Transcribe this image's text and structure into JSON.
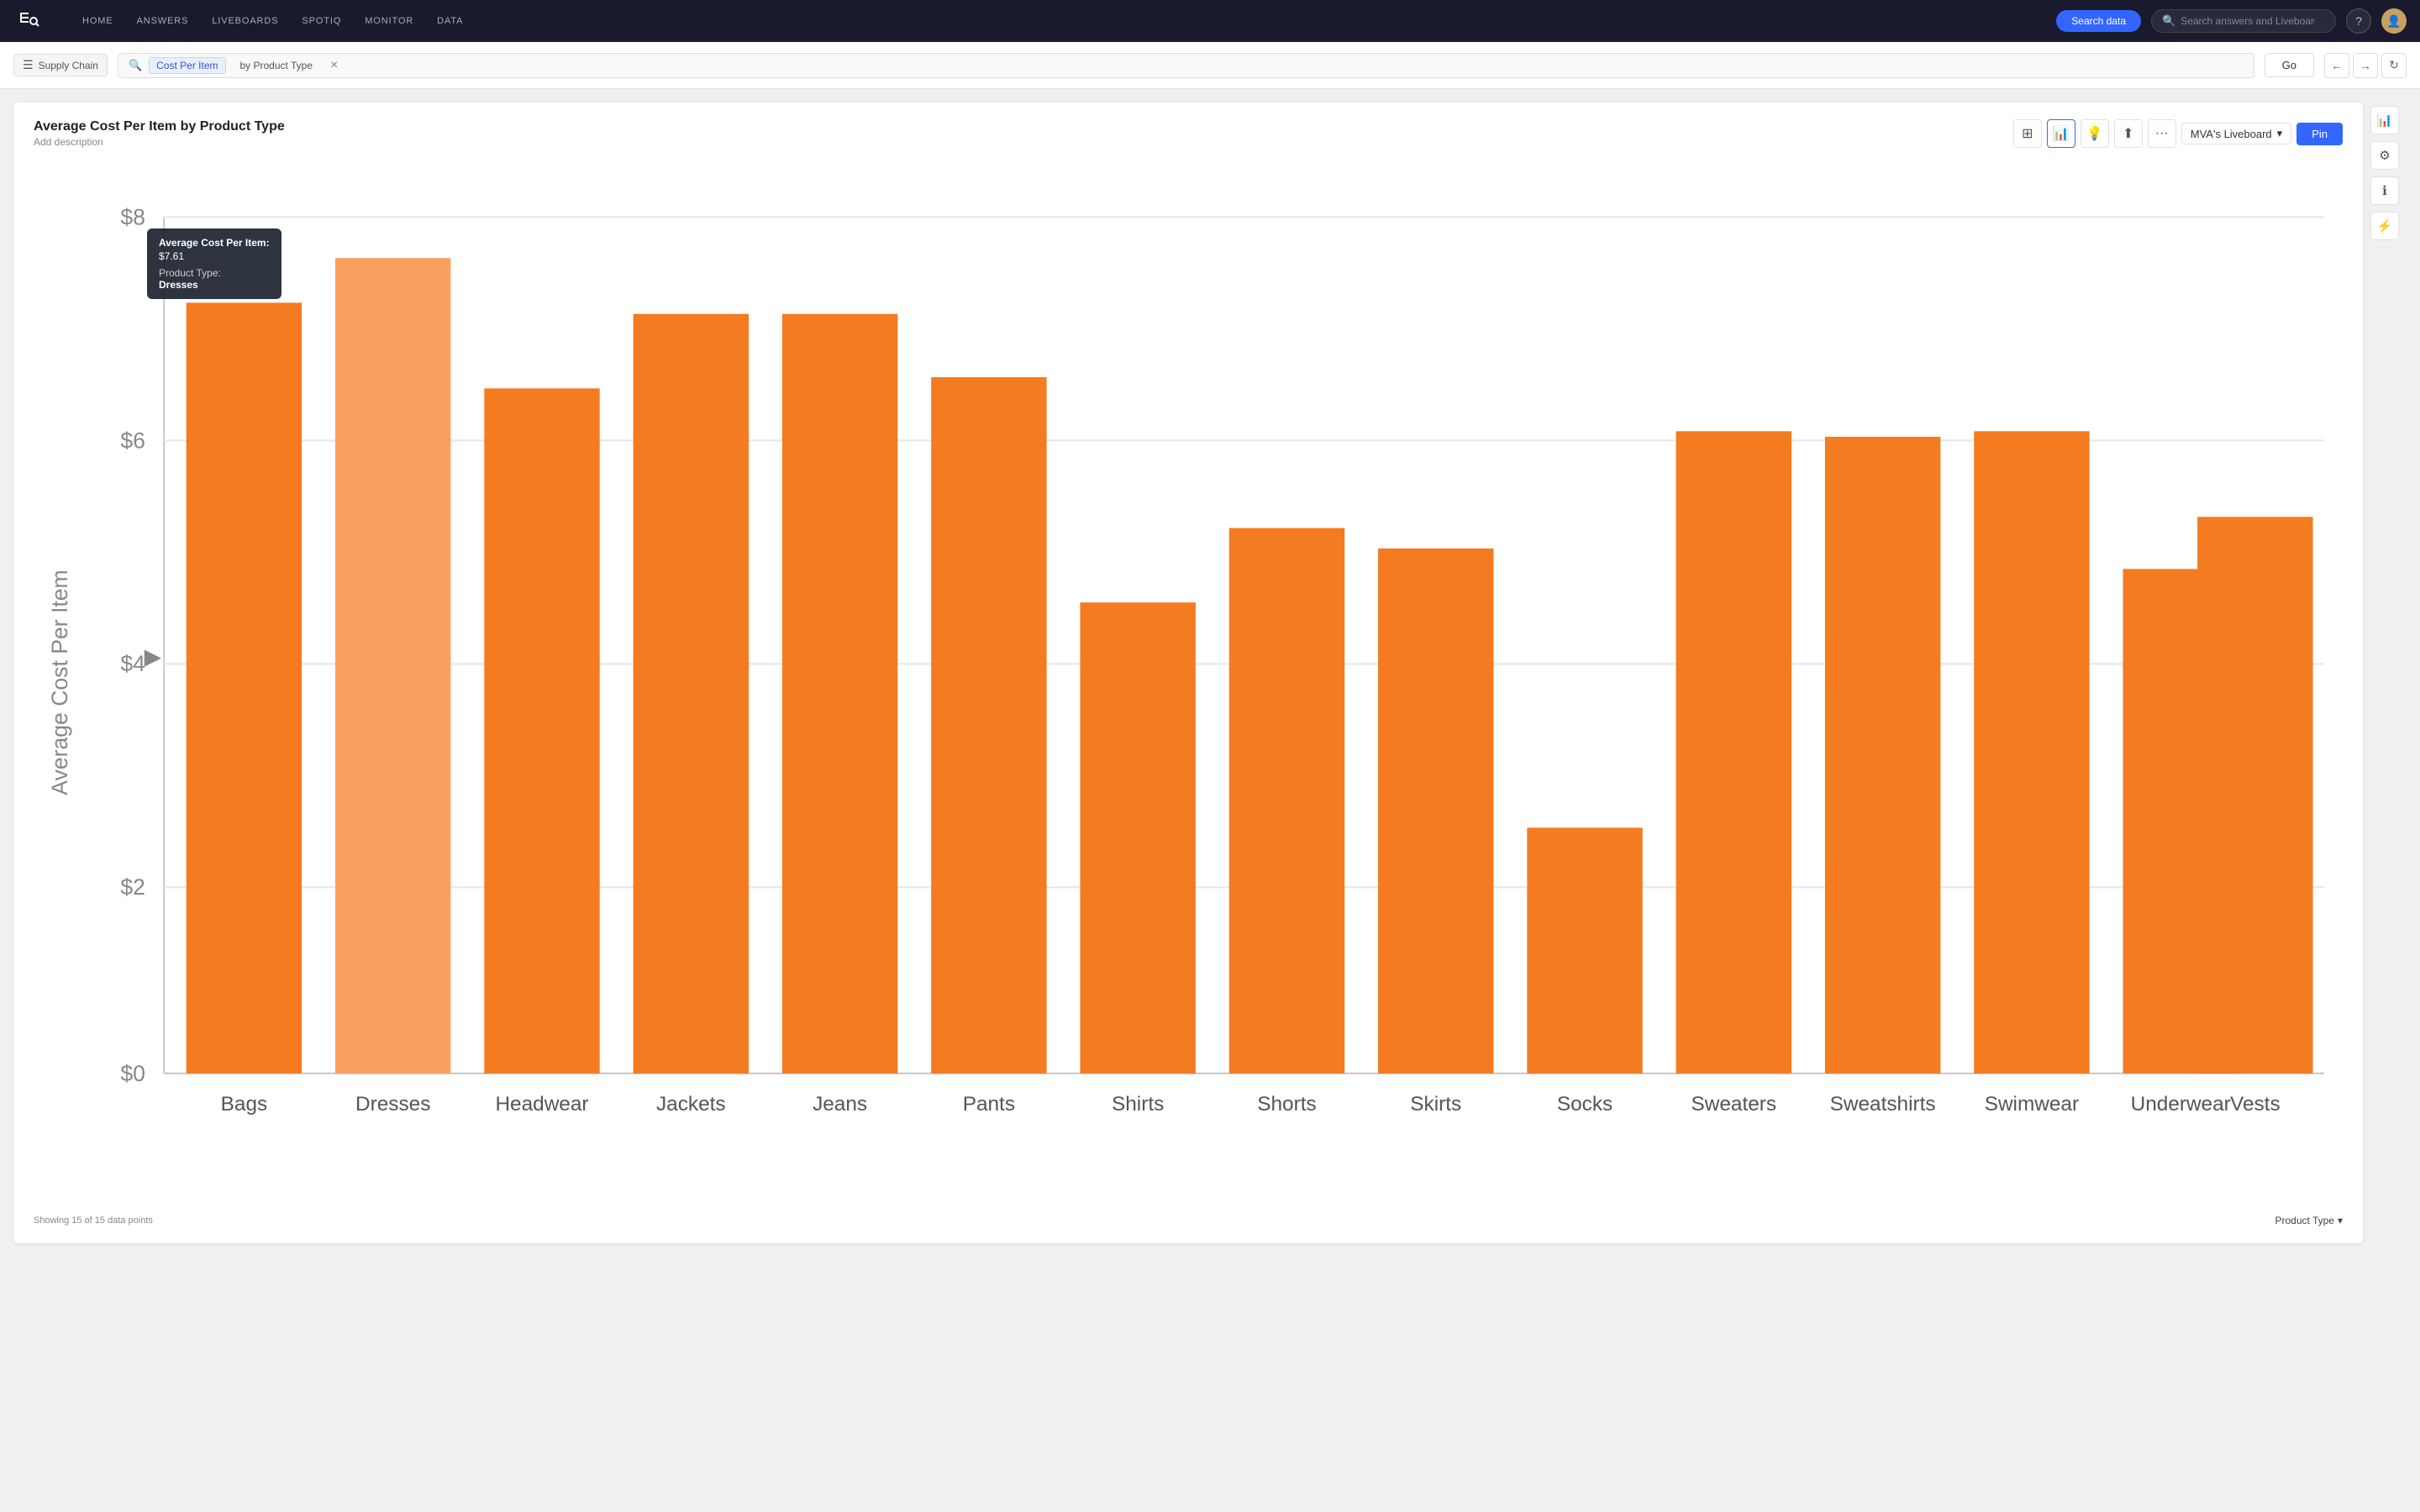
{
  "nav": {
    "links": [
      "HOME",
      "ANSWERS",
      "LIVEBOARDS",
      "SPOTIQ",
      "MONITOR",
      "DATA"
    ],
    "search_data_label": "Search data",
    "search_answers_placeholder": "Search answers and Liveboards"
  },
  "search_bar": {
    "source_icon": "≡",
    "source_label": "Supply Chain",
    "search_icon": "🔍",
    "token1": "Cost Per Item",
    "token2": "by Product Type",
    "go_label": "Go"
  },
  "chart": {
    "title": "Average Cost Per Item by Product Type",
    "subtitle": "Add description",
    "liveboard_label": "MVA's Liveboard",
    "pin_label": "Pin",
    "data_points_label": "Showing 15 of 15 data points",
    "x_axis_label": "Product Type",
    "y_axis_label": "Average Cost Per Item",
    "bars": [
      {
        "label": "Bags",
        "value": 7.2
      },
      {
        "label": "Dresses",
        "value": 7.61
      },
      {
        "label": "Headwear",
        "value": 6.4
      },
      {
        "label": "Jackets",
        "value": 7.1
      },
      {
        "label": "Jeans",
        "value": 7.1
      },
      {
        "label": "Pants",
        "value": 6.5
      },
      {
        "label": "Shirts",
        "value": 4.4
      },
      {
        "label": "Shorts",
        "value": 5.1
      },
      {
        "label": "Skirts",
        "value": 4.9
      },
      {
        "label": "Socks",
        "value": 2.3
      },
      {
        "label": "Sweaters",
        "value": 6.0
      },
      {
        "label": "Sweatshirts",
        "value": 5.95
      },
      {
        "label": "Swimwear",
        "value": 6.0
      },
      {
        "label": "Underwear",
        "value": 4.7
      },
      {
        "label": "Vests",
        "value": 5.2
      }
    ],
    "tooltip": {
      "label": "Average Cost Per Item:",
      "value": "$7.61",
      "type_label": "Product Type:",
      "type_value": "Dresses"
    },
    "y_ticks": [
      "$8",
      "$6",
      "$4",
      "$2",
      "$0"
    ],
    "max_value": 8
  }
}
